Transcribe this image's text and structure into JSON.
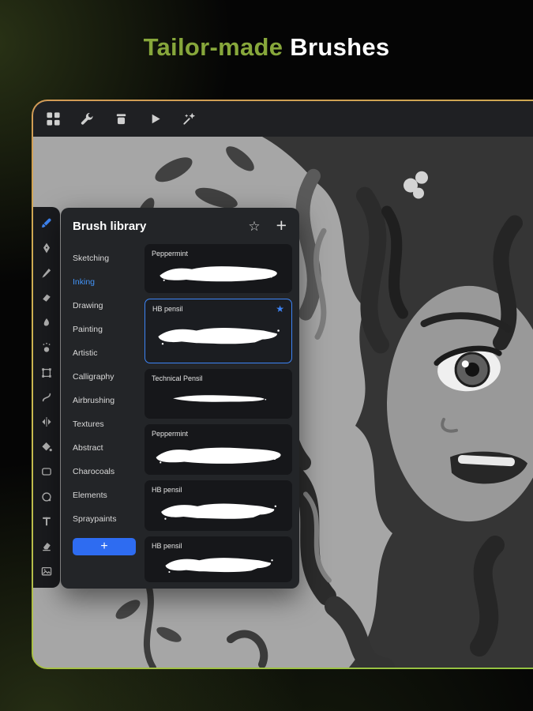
{
  "header": {
    "title_accent": "Tailor-made",
    "title_rest": "Brushes"
  },
  "toolbar": {
    "icons": [
      "gallery",
      "actions-wrench",
      "insert-jar",
      "play",
      "adjustments-wand"
    ]
  },
  "sidebar": {
    "tools": [
      {
        "name": "brush",
        "selected": true
      },
      {
        "name": "pen",
        "selected": false
      },
      {
        "name": "knife",
        "selected": false
      },
      {
        "name": "eraser-wedge",
        "selected": false
      },
      {
        "name": "smudge",
        "selected": false
      },
      {
        "name": "airbrush",
        "selected": false
      },
      {
        "name": "transform",
        "selected": false
      },
      {
        "name": "selection",
        "selected": false
      },
      {
        "name": "symmetry",
        "selected": false
      },
      {
        "name": "fill",
        "selected": false
      },
      {
        "name": "shape",
        "selected": false
      },
      {
        "name": "ellipse",
        "selected": false
      },
      {
        "name": "text",
        "selected": false
      },
      {
        "name": "block-eraser",
        "selected": false
      },
      {
        "name": "image",
        "selected": false
      }
    ]
  },
  "brush_library": {
    "title": "Brush library",
    "star_icon": "☆",
    "add_icon": "+",
    "starred_icon": "★",
    "add_button_label": "+",
    "categories": [
      {
        "label": "Sketching",
        "selected": false
      },
      {
        "label": "Inking",
        "selected": true
      },
      {
        "label": "Drawing",
        "selected": false
      },
      {
        "label": "Painting",
        "selected": false
      },
      {
        "label": "Artistic",
        "selected": false
      },
      {
        "label": "Calligraphy",
        "selected": false
      },
      {
        "label": "Airbrushing",
        "selected": false
      },
      {
        "label": "Textures",
        "selected": false
      },
      {
        "label": "Abstract",
        "selected": false
      },
      {
        "label": "Charocoals",
        "selected": false
      },
      {
        "label": "Elements",
        "selected": false
      },
      {
        "label": "Spraypaints",
        "selected": false
      }
    ],
    "brushes": [
      {
        "name": "Peppermint",
        "selected": false,
        "starred": false
      },
      {
        "name": "HB pensil",
        "selected": true,
        "starred": true
      },
      {
        "name": "Technical Pensil",
        "selected": false,
        "starred": false
      },
      {
        "name": "Peppermint",
        "selected": false,
        "starred": false
      },
      {
        "name": "HB pensil",
        "selected": false,
        "starred": false
      },
      {
        "name": "HB pensil",
        "selected": false,
        "starred": false
      }
    ]
  },
  "colors": {
    "accent_blue": "#3d85f7",
    "title_green": "#87a73b",
    "border_gradient_start": "#d29a55",
    "border_gradient_end": "#93c341",
    "panel_bg": "#232528",
    "card_bg": "#16171a"
  }
}
